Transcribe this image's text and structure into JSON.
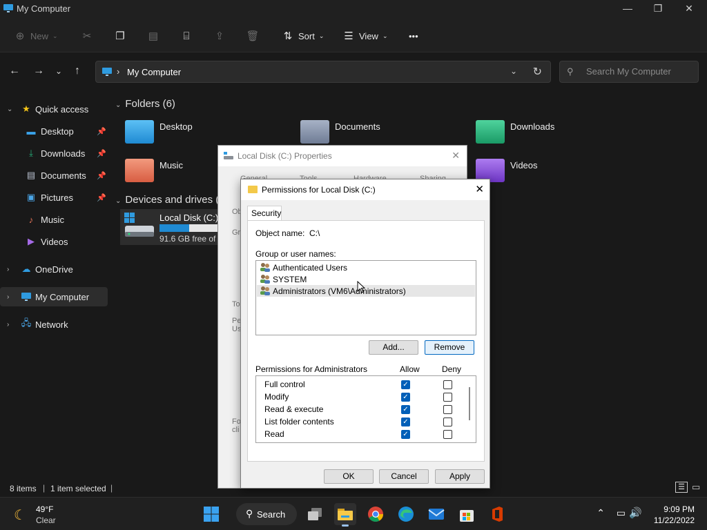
{
  "window": {
    "title": "My Computer",
    "min": "—",
    "max": "❐",
    "close": "✕"
  },
  "toolbar": {
    "new_label": "New",
    "sort_label": "Sort",
    "view_label": "View",
    "more_label": "•••"
  },
  "address": {
    "path": "My Computer",
    "search_placeholder": "Search My Computer"
  },
  "sidebar": {
    "quick_access": "Quick access",
    "items": [
      {
        "label": "Desktop"
      },
      {
        "label": "Downloads"
      },
      {
        "label": "Documents"
      },
      {
        "label": "Pictures"
      },
      {
        "label": "Music"
      },
      {
        "label": "Videos"
      }
    ],
    "onedrive": "OneDrive",
    "my_computer": "My Computer",
    "network": "Network"
  },
  "main": {
    "folders_heading": "Folders (6)",
    "folders": [
      {
        "label": "Desktop",
        "color": "#2ea3e6"
      },
      {
        "label": "Documents",
        "color": "#8f9bb3"
      },
      {
        "label": "Downloads",
        "color": "#27b07a"
      },
      {
        "label": "Music",
        "color": "#e8765a"
      },
      {
        "label": "Videos",
        "color": "#8a4fd8"
      }
    ],
    "drives_heading": "Devices and drives (",
    "drive": {
      "label": "Local Disk (C:)",
      "free": "91.6 GB free of 1",
      "used_fraction": 0.48
    }
  },
  "status": {
    "items": "8 items",
    "selected": "1 item selected"
  },
  "props_dialog": {
    "title": "Local Disk (C:) Properties",
    "tabs": [
      "General",
      "Tools",
      "Hardware",
      "Sharing"
    ],
    "frag_ob": "Ob",
    "frag_gr": "Gr",
    "frag_to": "To",
    "frag_pe": "Pe",
    "frag_us": "Us",
    "frag_fo": "Fo",
    "frag_cli": "cli"
  },
  "perm_dialog": {
    "title": "Permissions for Local Disk (C:)",
    "close": "✕",
    "tab": "Security",
    "object_label": "Object name:",
    "object_value": "C:\\",
    "group_label": "Group or user names:",
    "users": [
      {
        "name": "Authenticated Users"
      },
      {
        "name": "SYSTEM"
      },
      {
        "name": "Administrators (VM6\\Administrators)"
      }
    ],
    "add_button": "Add...",
    "remove_button": "Remove",
    "perm_header": "Permissions for Administrators",
    "allow_header": "Allow",
    "deny_header": "Deny",
    "permissions": [
      {
        "name": "Full control",
        "allow": true,
        "deny": false
      },
      {
        "name": "Modify",
        "allow": true,
        "deny": false
      },
      {
        "name": "Read & execute",
        "allow": true,
        "deny": false
      },
      {
        "name": "List folder contents",
        "allow": true,
        "deny": false
      },
      {
        "name": "Read",
        "allow": true,
        "deny": false
      }
    ],
    "ok_button": "OK",
    "cancel_button": "Cancel",
    "apply_button": "Apply"
  },
  "taskbar": {
    "temp": "49°F",
    "condition": "Clear",
    "search_label": "Search",
    "time": "9:09 PM",
    "date": "11/22/2022"
  }
}
